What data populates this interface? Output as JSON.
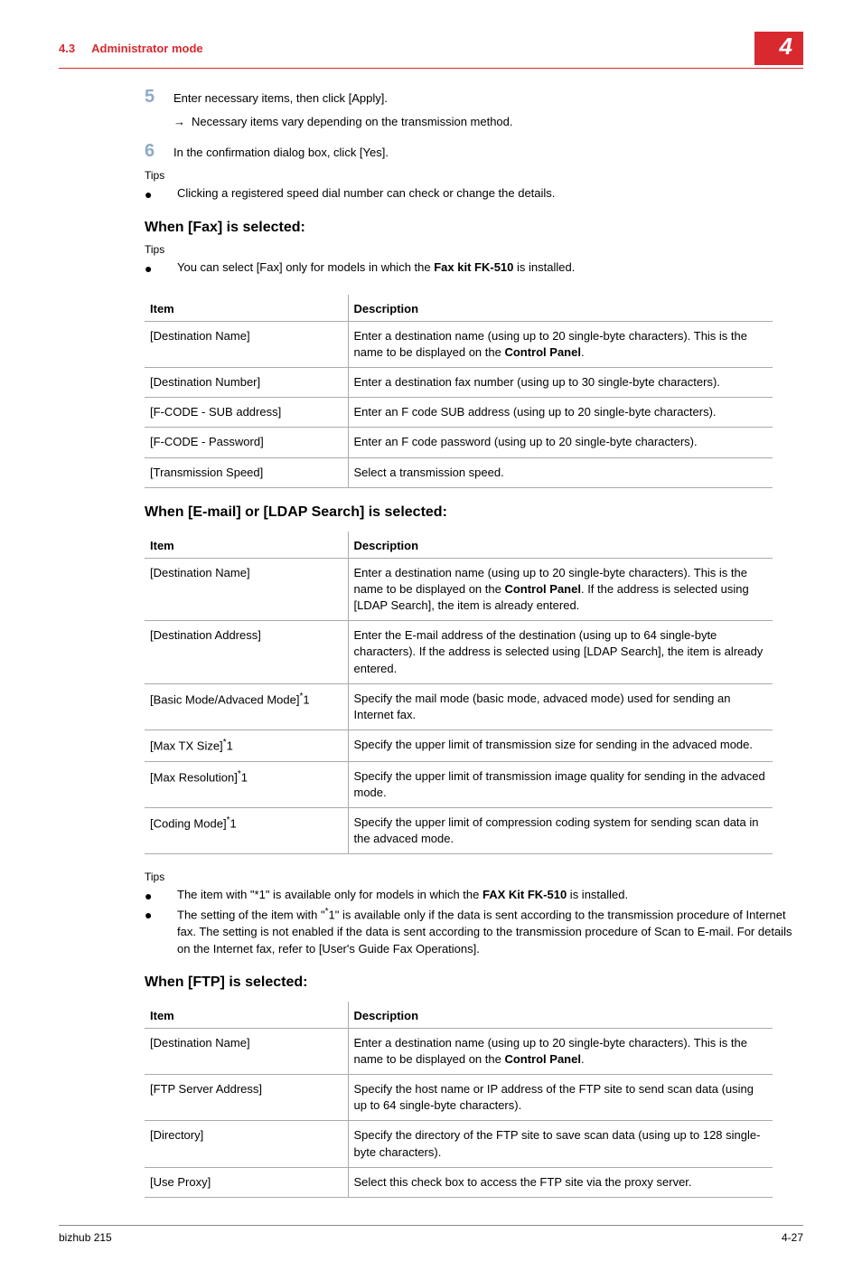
{
  "header": {
    "section_num": "4.3",
    "section_title": "Administrator mode",
    "chapter_num": "4"
  },
  "step5": {
    "num": "5",
    "text": "Enter necessary items, then click [Apply].",
    "sub_arrow": "→",
    "sub_text": "Necessary items vary depending on the transmission method."
  },
  "step6": {
    "num": "6",
    "text": "In the confirmation dialog box, click [Yes]."
  },
  "tips1": {
    "label": "Tips",
    "bullet1": "Clicking a registered speed dial number can check or change the details."
  },
  "fax_section": {
    "heading": "When [Fax] is selected:",
    "tips_label": "Tips",
    "tips_bullet_prefix": "You can select [Fax] only for models in which the ",
    "tips_bullet_bold": "Fax kit FK-510",
    "tips_bullet_suffix": " is installed.",
    "th_item": "Item",
    "th_desc": "Description",
    "rows": [
      {
        "item": "[Destination Name]",
        "desc_pre": "Enter a destination name (using up to 20 single-byte characters). This is the name to be displayed on the ",
        "desc_bold": "Control Panel",
        "desc_post": "."
      },
      {
        "item": "[Destination Number]",
        "desc": "Enter a destination fax number (using up to 30 single-byte characters)."
      },
      {
        "item": "[F-CODE - SUB address]",
        "desc": "Enter an F code SUB address (using up to 20 single-byte characters)."
      },
      {
        "item": "[F-CODE - Password]",
        "desc": "Enter an F code password (using up to 20 single-byte characters)."
      },
      {
        "item": "[Transmission Speed]",
        "desc": "Select a transmission speed."
      }
    ]
  },
  "email_section": {
    "heading": "When [E-mail] or [LDAP Search] is selected:",
    "th_item": "Item",
    "th_desc": "Description",
    "rows": [
      {
        "item": "[Destination Name]",
        "desc_pre": "Enter a destination name (using up to 20 single-byte characters). This is the name to be displayed on the ",
        "desc_bold": "Control Panel",
        "desc_post": ". If the address is selected using [LDAP Search], the item is already entered."
      },
      {
        "item": "[Destination Address]",
        "desc": "Enter the E-mail address of the destination (using up to 64 single-byte characters). If the address is selected using [LDAP Search], the item is already entered."
      },
      {
        "item_pre": "[Basic Mode/Advaced Mode]",
        "item_sup": "*",
        "item_post": "1",
        "desc": "Specify the mail mode (basic mode, advaced mode) used for sending an Internet fax."
      },
      {
        "item_pre": "[Max TX Size]",
        "item_sup": "*",
        "item_post": "1",
        "desc": "Specify the upper limit of transmission size for sending in the advaced mode."
      },
      {
        "item_pre": "[Max Resolution]",
        "item_sup": "*",
        "item_post": "1",
        "desc": "Specify the upper limit of transmission image quality for sending in the advaced mode."
      },
      {
        "item_pre": "[Coding Mode]",
        "item_sup": "*",
        "item_post": "1",
        "desc": "Specify the upper limit of compression coding system for sending scan data in the advaced mode."
      }
    ],
    "tips_label": "Tips",
    "tips_bullets": [
      {
        "pre": "The item with \"*1\" is available only for models in which the ",
        "bold": "FAX Kit FK-510",
        "post": " is installed."
      },
      {
        "pre": "The setting of the item with \"",
        "sup": "*",
        "mid": "1\" is available only if the data is sent according to the transmission procedure of Internet fax. The setting is not enabled if the data is sent according to the transmission procedure of Scan to E-mail. For details on the Internet fax, refer to [User's Guide Fax Operations]."
      }
    ]
  },
  "ftp_section": {
    "heading": "When [FTP] is selected:",
    "th_item": "Item",
    "th_desc": "Description",
    "rows": [
      {
        "item": "[Destination Name]",
        "desc_pre": "Enter a destination name (using up to 20 single-byte characters). This is the name to be displayed on the ",
        "desc_bold": "Control Panel",
        "desc_post": "."
      },
      {
        "item": "[FTP Server Address]",
        "desc": "Specify the host name or IP address of the FTP site to send scan data (using up to 64 single-byte characters)."
      },
      {
        "item": "[Directory]",
        "desc": "Specify the directory of the FTP site to save scan data (using up to 128 single-byte characters)."
      },
      {
        "item": "[Use Proxy]",
        "desc": "Select this check box to access the FTP site via the proxy server."
      }
    ]
  },
  "footer": {
    "left": "bizhub 215",
    "right": "4-27"
  }
}
